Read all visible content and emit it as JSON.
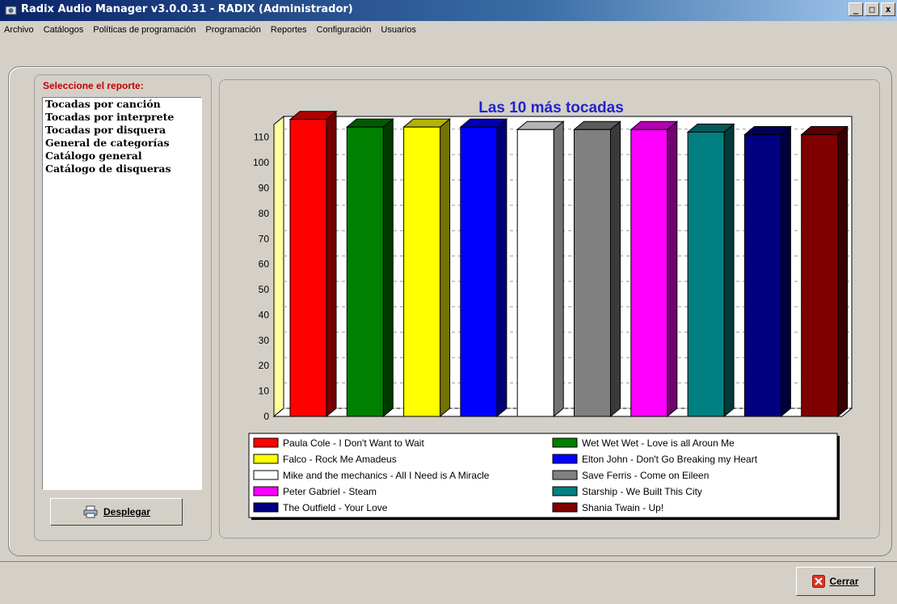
{
  "window": {
    "title": "Radix Audio Manager v3.0.0.31 - RADIX (Administrador)",
    "minimize": "_",
    "maximize": "□",
    "close": "x"
  },
  "menu": [
    "Archivo",
    "Catálogos",
    "Políticas de programación",
    "Programación",
    "Reportes",
    "Configuración",
    "Usuarios"
  ],
  "sidebar": {
    "legend": "Seleccione el reporte:",
    "reports": [
      "Tocadas por canción",
      "Tocadas por interprete",
      "Tocadas por disquera",
      "General de categorías",
      "Catálogo general",
      "Catálogo de disqueras"
    ],
    "deploy_label": "Desplegar",
    "deploy_icon": "printer-icon"
  },
  "footer": {
    "close_label": "Cerrar",
    "close_icon": "close-x-icon"
  },
  "chart_data": {
    "type": "bar",
    "title": "Las 10 más tocadas",
    "title_color": "#2222cc",
    "ylim": [
      0,
      115
    ],
    "yticks": [
      0,
      10,
      20,
      30,
      40,
      50,
      60,
      70,
      80,
      90,
      100,
      110
    ],
    "grid": true,
    "legend_position": "bottom",
    "series": [
      {
        "name": "Paula Cole - I Don't Want to Wait",
        "value": 117,
        "color": "#ff0000"
      },
      {
        "name": "Wet Wet Wet - Love is all Aroun Me",
        "value": 114,
        "color": "#008000"
      },
      {
        "name": "Falco - Rock Me Amadeus",
        "value": 114,
        "color": "#ffff00"
      },
      {
        "name": "Elton John - Don't Go Breaking my Heart",
        "value": 114,
        "color": "#0000ff"
      },
      {
        "name": "Mike and the mechanics - All I Need is A Miracle",
        "value": 113,
        "color": "#ffffff"
      },
      {
        "name": "Save Ferris - Come on Eileen",
        "value": 113,
        "color": "#808080"
      },
      {
        "name": "Peter Gabriel - Steam",
        "value": 113,
        "color": "#ff00ff"
      },
      {
        "name": "Starship - We Built This City",
        "value": 112,
        "color": "#008080"
      },
      {
        "name": "The Outfield - Your Love",
        "value": 111,
        "color": "#000080"
      },
      {
        "name": "Shania Twain - Up!",
        "value": 111,
        "color": "#800000"
      }
    ]
  }
}
